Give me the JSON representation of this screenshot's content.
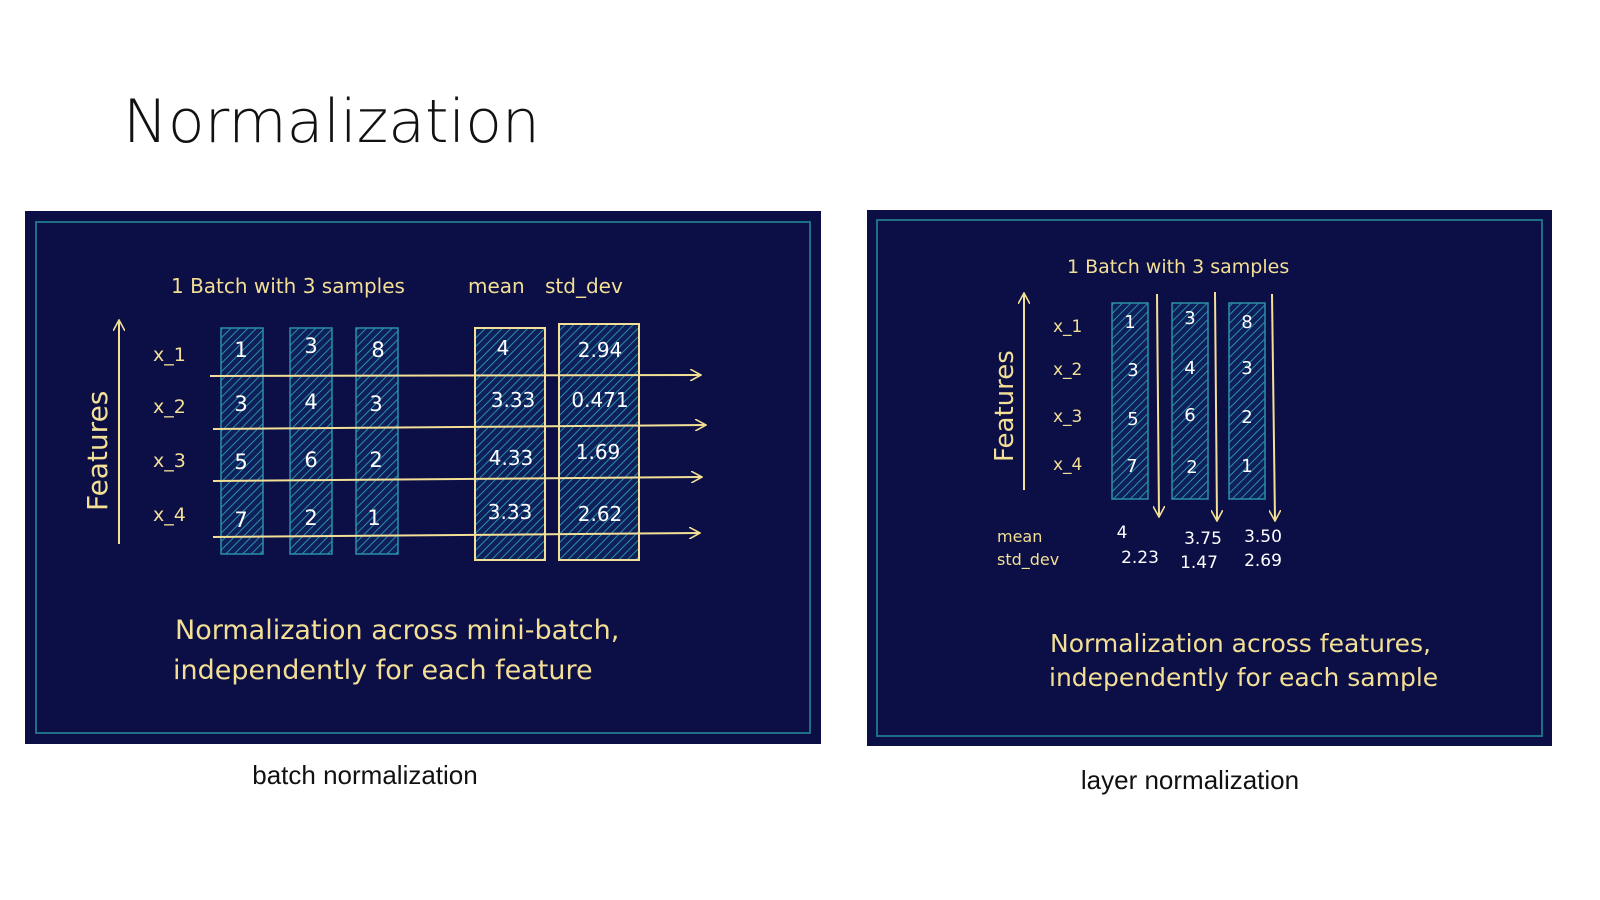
{
  "slide": {
    "title": "Normalization"
  },
  "colors": {
    "panel_bg": "#0b0f45",
    "frame": "#1e6f86",
    "hand_text": "#f3df95",
    "cell_hatch": "#2a8fa8",
    "number": "#ffffff"
  },
  "batch_panel": {
    "header": "1 Batch with 3 samples",
    "mean_label": "mean",
    "std_label": "std_dev",
    "axis_label": "Features",
    "features": [
      "x_1",
      "x_2",
      "x_3",
      "x_4"
    ],
    "samples": [
      [
        "1",
        "3",
        "5",
        "7"
      ],
      [
        "3",
        "4",
        "6",
        "2"
      ],
      [
        "8",
        "3",
        "2",
        "1"
      ]
    ],
    "means": [
      "4",
      "3.33",
      "4.33",
      "3.33"
    ],
    "std_devs": [
      "2.94",
      "0.471",
      "1.69",
      "2.62"
    ],
    "note_line1": "Normalization across mini-batch,",
    "note_line2": "independently for each feature",
    "caption": "batch normalization"
  },
  "layer_panel": {
    "header": "1 Batch with 3 samples",
    "axis_label": "Features",
    "features": [
      "x_1",
      "x_2",
      "x_3",
      "x_4"
    ],
    "samples": [
      [
        "1",
        "3",
        "5",
        "7"
      ],
      [
        "3",
        "4",
        "6",
        "2"
      ],
      [
        "8",
        "3",
        "2",
        "1"
      ]
    ],
    "mean_label": "mean",
    "std_label": "std_dev",
    "means": [
      "4",
      "3.75",
      "3.50"
    ],
    "std_devs": [
      "2.23",
      "1.47",
      "2.69"
    ],
    "note_line1": "Normalization across features,",
    "note_line2": "independently for each sample",
    "caption": "layer normalization"
  }
}
